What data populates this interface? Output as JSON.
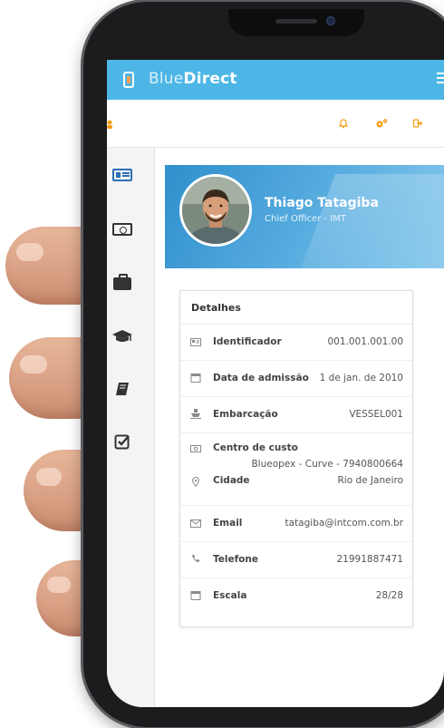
{
  "app": {
    "brand_light": "Blue",
    "brand_bold": "Direct",
    "accent_color": "#4db6e6"
  },
  "toolbar": {
    "icons": [
      "user-icon",
      "bell-icon",
      "cogs-icon",
      "sign-out-icon"
    ]
  },
  "sidebar": {
    "items": [
      {
        "icon": "id-card-icon",
        "active": true
      },
      {
        "icon": "money-icon"
      },
      {
        "icon": "briefcase-icon"
      },
      {
        "icon": "graduation-cap-icon"
      },
      {
        "icon": "book-icon"
      },
      {
        "icon": "check-square-icon"
      }
    ]
  },
  "profile": {
    "name": "Thiago Tatagiba",
    "role": "Chief Officer - IMT"
  },
  "details": {
    "title": "Detalhes",
    "rows": [
      {
        "icon": "id-badge-icon",
        "label": "Identificador",
        "value": "001.001.001.00"
      },
      {
        "icon": "calendar-icon",
        "label": "Data de admissão",
        "value": "1 de jan. de 2010"
      },
      {
        "icon": "ship-icon",
        "label": "Embarcação",
        "value": "VESSEL001"
      },
      {
        "icon": "money-icon",
        "label": "Centro de custo",
        "value": "Blueopex - Curve - 7940800664"
      },
      {
        "icon": "map-marker-icon",
        "label": "Cidade",
        "value": "Rio de Janeiro"
      },
      {
        "icon": "envelope-icon",
        "label": "Email",
        "value": "tatagiba@intcom.com.br"
      },
      {
        "icon": "phone-icon",
        "label": "Telefone",
        "value": "21991887471"
      },
      {
        "icon": "calendar-icon",
        "label": "Escala",
        "value": "28/28"
      }
    ]
  }
}
